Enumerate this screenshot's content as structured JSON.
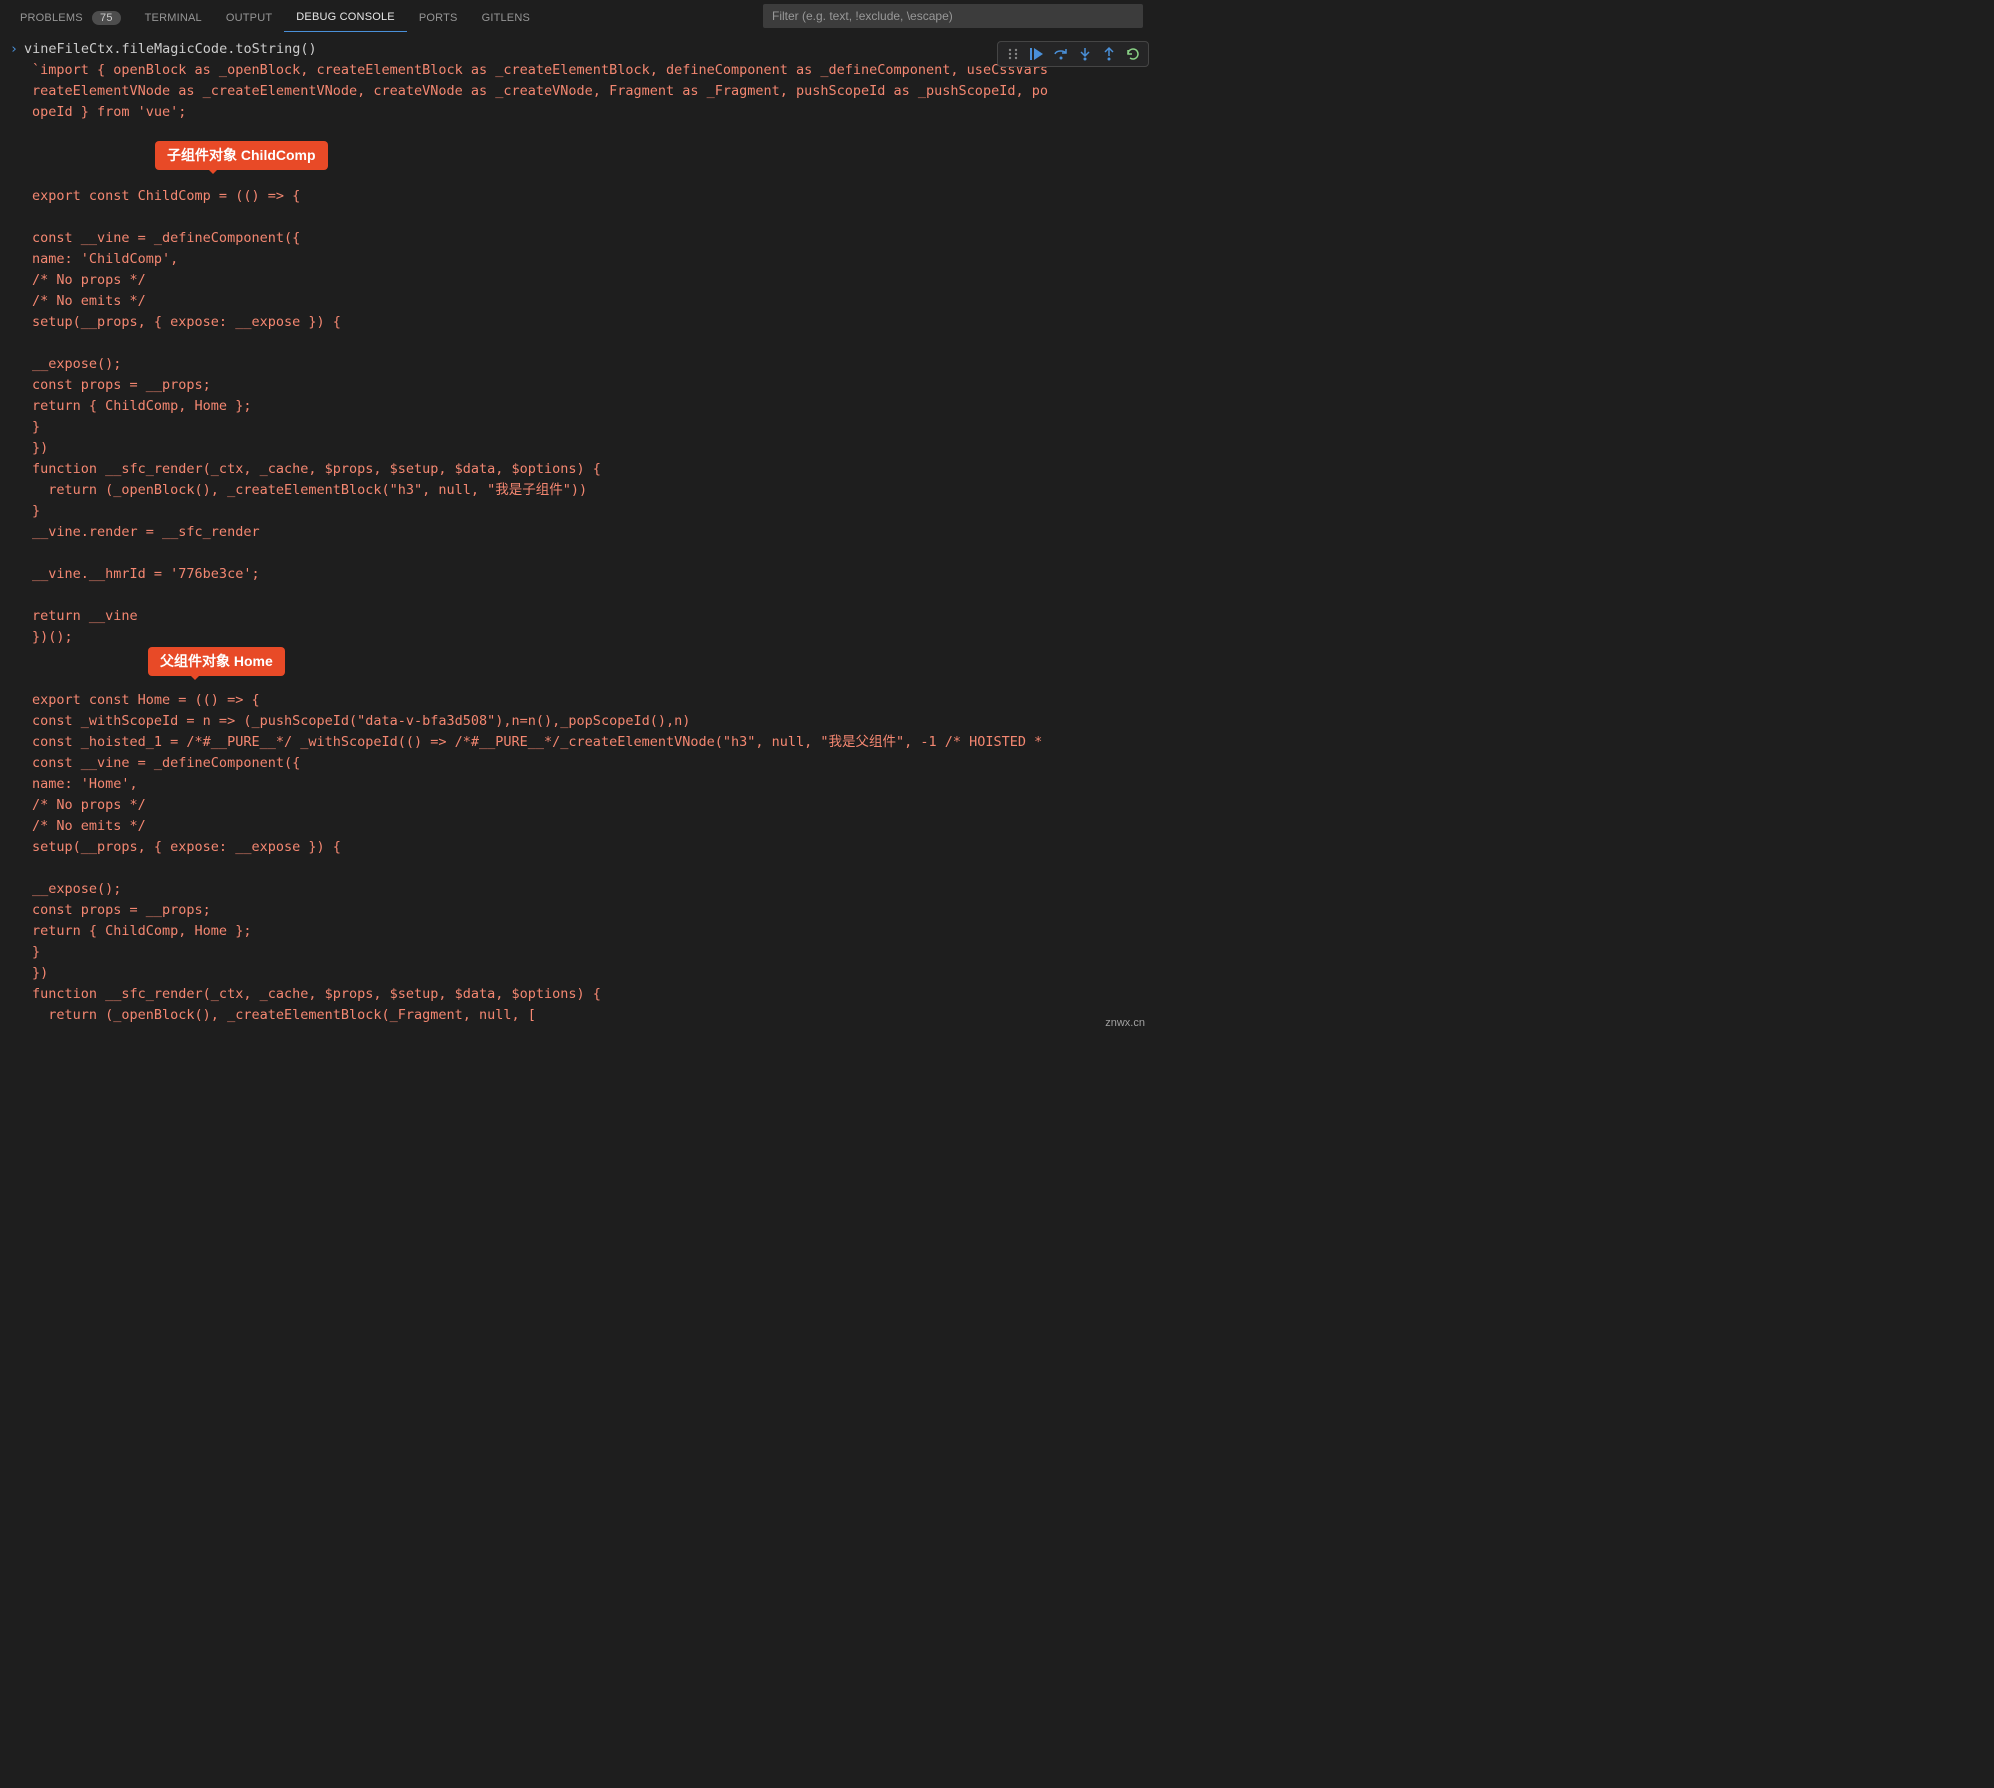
{
  "tabs": {
    "problems": "PROBLEMS",
    "problems_count": "75",
    "terminal": "TERMINAL",
    "output": "OUTPUT",
    "debug_console": "DEBUG CONSOLE",
    "ports": "PORTS",
    "gitlens": "GITLENS"
  },
  "filter": {
    "placeholder": "Filter (e.g. text, !exclude, \\escape)"
  },
  "prompt": {
    "expression": "vineFileCtx.fileMagicCode.toString()"
  },
  "callouts": {
    "child": "子组件对象 ChildComp",
    "home": "父组件对象 Home"
  },
  "code_lines": [
    "`import { openBlock as _openBlock, createElementBlock as _createElementBlock, defineComponent as _defineComponent, useCssVars",
    "reateElementVNode as _createElementVNode, createVNode as _createVNode, Fragment as _Fragment, pushScopeId as _pushScopeId, po",
    "opeId } from 'vue';",
    "",
    "",
    "",
    "export const ChildComp = (() => {",
    "",
    "const __vine = _defineComponent({",
    "name: 'ChildComp',",
    "/* No props */",
    "/* No emits */",
    "setup(__props, { expose: __expose }) {",
    "",
    "__expose();",
    "const props = __props;",
    "return { ChildComp, Home };",
    "}",
    "})",
    "function __sfc_render(_ctx, _cache, $props, $setup, $data, $options) {",
    "  return (_openBlock(), _createElementBlock(\"h3\", null, \"我是子组件\"))",
    "}",
    "__vine.render = __sfc_render",
    "",
    "__vine.__hmrId = '776be3ce';",
    "",
    "return __vine",
    "})();",
    "",
    "",
    "export const Home = (() => {",
    "const _withScopeId = n => (_pushScopeId(\"data-v-bfa3d508\"),n=n(),_popScopeId(),n)",
    "const _hoisted_1 = /*#__PURE__*/ _withScopeId(() => /*#__PURE__*/_createElementVNode(\"h3\", null, \"我是父组件\", -1 /* HOISTED *",
    "const __vine = _defineComponent({",
    "name: 'Home',",
    "/* No props */",
    "/* No emits */",
    "setup(__props, { expose: __expose }) {",
    "",
    "__expose();",
    "const props = __props;",
    "return { ChildComp, Home };",
    "}",
    "})",
    "function __sfc_render(_ctx, _cache, $props, $setup, $data, $options) {",
    "  return (_openBlock(), _createElementBlock(_Fragment, null, ["
  ],
  "watermark": "znwx.cn"
}
